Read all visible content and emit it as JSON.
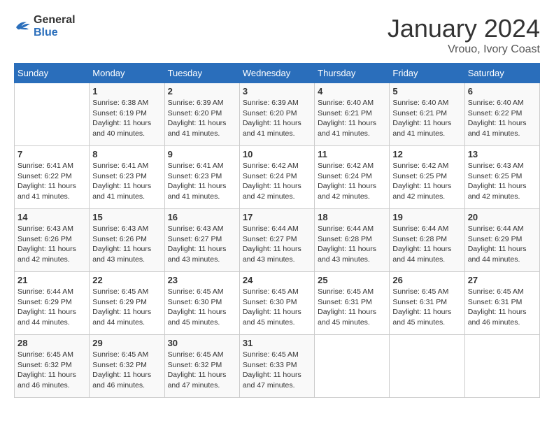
{
  "header": {
    "logo_general": "General",
    "logo_blue": "Blue",
    "month": "January 2024",
    "location": "Vrouo, Ivory Coast"
  },
  "weekdays": [
    "Sunday",
    "Monday",
    "Tuesday",
    "Wednesday",
    "Thursday",
    "Friday",
    "Saturday"
  ],
  "weeks": [
    [
      {
        "day": "",
        "sunrise": "",
        "sunset": "",
        "daylight": ""
      },
      {
        "day": "1",
        "sunrise": "Sunrise: 6:38 AM",
        "sunset": "Sunset: 6:19 PM",
        "daylight": "Daylight: 11 hours and 40 minutes."
      },
      {
        "day": "2",
        "sunrise": "Sunrise: 6:39 AM",
        "sunset": "Sunset: 6:20 PM",
        "daylight": "Daylight: 11 hours and 41 minutes."
      },
      {
        "day": "3",
        "sunrise": "Sunrise: 6:39 AM",
        "sunset": "Sunset: 6:20 PM",
        "daylight": "Daylight: 11 hours and 41 minutes."
      },
      {
        "day": "4",
        "sunrise": "Sunrise: 6:40 AM",
        "sunset": "Sunset: 6:21 PM",
        "daylight": "Daylight: 11 hours and 41 minutes."
      },
      {
        "day": "5",
        "sunrise": "Sunrise: 6:40 AM",
        "sunset": "Sunset: 6:21 PM",
        "daylight": "Daylight: 11 hours and 41 minutes."
      },
      {
        "day": "6",
        "sunrise": "Sunrise: 6:40 AM",
        "sunset": "Sunset: 6:22 PM",
        "daylight": "Daylight: 11 hours and 41 minutes."
      }
    ],
    [
      {
        "day": "7",
        "sunrise": "Sunrise: 6:41 AM",
        "sunset": "Sunset: 6:22 PM",
        "daylight": "Daylight: 11 hours and 41 minutes."
      },
      {
        "day": "8",
        "sunrise": "Sunrise: 6:41 AM",
        "sunset": "Sunset: 6:23 PM",
        "daylight": "Daylight: 11 hours and 41 minutes."
      },
      {
        "day": "9",
        "sunrise": "Sunrise: 6:41 AM",
        "sunset": "Sunset: 6:23 PM",
        "daylight": "Daylight: 11 hours and 41 minutes."
      },
      {
        "day": "10",
        "sunrise": "Sunrise: 6:42 AM",
        "sunset": "Sunset: 6:24 PM",
        "daylight": "Daylight: 11 hours and 42 minutes."
      },
      {
        "day": "11",
        "sunrise": "Sunrise: 6:42 AM",
        "sunset": "Sunset: 6:24 PM",
        "daylight": "Daylight: 11 hours and 42 minutes."
      },
      {
        "day": "12",
        "sunrise": "Sunrise: 6:42 AM",
        "sunset": "Sunset: 6:25 PM",
        "daylight": "Daylight: 11 hours and 42 minutes."
      },
      {
        "day": "13",
        "sunrise": "Sunrise: 6:43 AM",
        "sunset": "Sunset: 6:25 PM",
        "daylight": "Daylight: 11 hours and 42 minutes."
      }
    ],
    [
      {
        "day": "14",
        "sunrise": "Sunrise: 6:43 AM",
        "sunset": "Sunset: 6:26 PM",
        "daylight": "Daylight: 11 hours and 42 minutes."
      },
      {
        "day": "15",
        "sunrise": "Sunrise: 6:43 AM",
        "sunset": "Sunset: 6:26 PM",
        "daylight": "Daylight: 11 hours and 43 minutes."
      },
      {
        "day": "16",
        "sunrise": "Sunrise: 6:43 AM",
        "sunset": "Sunset: 6:27 PM",
        "daylight": "Daylight: 11 hours and 43 minutes."
      },
      {
        "day": "17",
        "sunrise": "Sunrise: 6:44 AM",
        "sunset": "Sunset: 6:27 PM",
        "daylight": "Daylight: 11 hours and 43 minutes."
      },
      {
        "day": "18",
        "sunrise": "Sunrise: 6:44 AM",
        "sunset": "Sunset: 6:28 PM",
        "daylight": "Daylight: 11 hours and 43 minutes."
      },
      {
        "day": "19",
        "sunrise": "Sunrise: 6:44 AM",
        "sunset": "Sunset: 6:28 PM",
        "daylight": "Daylight: 11 hours and 44 minutes."
      },
      {
        "day": "20",
        "sunrise": "Sunrise: 6:44 AM",
        "sunset": "Sunset: 6:29 PM",
        "daylight": "Daylight: 11 hours and 44 minutes."
      }
    ],
    [
      {
        "day": "21",
        "sunrise": "Sunrise: 6:44 AM",
        "sunset": "Sunset: 6:29 PM",
        "daylight": "Daylight: 11 hours and 44 minutes."
      },
      {
        "day": "22",
        "sunrise": "Sunrise: 6:45 AM",
        "sunset": "Sunset: 6:29 PM",
        "daylight": "Daylight: 11 hours and 44 minutes."
      },
      {
        "day": "23",
        "sunrise": "Sunrise: 6:45 AM",
        "sunset": "Sunset: 6:30 PM",
        "daylight": "Daylight: 11 hours and 45 minutes."
      },
      {
        "day": "24",
        "sunrise": "Sunrise: 6:45 AM",
        "sunset": "Sunset: 6:30 PM",
        "daylight": "Daylight: 11 hours and 45 minutes."
      },
      {
        "day": "25",
        "sunrise": "Sunrise: 6:45 AM",
        "sunset": "Sunset: 6:31 PM",
        "daylight": "Daylight: 11 hours and 45 minutes."
      },
      {
        "day": "26",
        "sunrise": "Sunrise: 6:45 AM",
        "sunset": "Sunset: 6:31 PM",
        "daylight": "Daylight: 11 hours and 45 minutes."
      },
      {
        "day": "27",
        "sunrise": "Sunrise: 6:45 AM",
        "sunset": "Sunset: 6:31 PM",
        "daylight": "Daylight: 11 hours and 46 minutes."
      }
    ],
    [
      {
        "day": "28",
        "sunrise": "Sunrise: 6:45 AM",
        "sunset": "Sunset: 6:32 PM",
        "daylight": "Daylight: 11 hours and 46 minutes."
      },
      {
        "day": "29",
        "sunrise": "Sunrise: 6:45 AM",
        "sunset": "Sunset: 6:32 PM",
        "daylight": "Daylight: 11 hours and 46 minutes."
      },
      {
        "day": "30",
        "sunrise": "Sunrise: 6:45 AM",
        "sunset": "Sunset: 6:32 PM",
        "daylight": "Daylight: 11 hours and 47 minutes."
      },
      {
        "day": "31",
        "sunrise": "Sunrise: 6:45 AM",
        "sunset": "Sunset: 6:33 PM",
        "daylight": "Daylight: 11 hours and 47 minutes."
      },
      {
        "day": "",
        "sunrise": "",
        "sunset": "",
        "daylight": ""
      },
      {
        "day": "",
        "sunrise": "",
        "sunset": "",
        "daylight": ""
      },
      {
        "day": "",
        "sunrise": "",
        "sunset": "",
        "daylight": ""
      }
    ]
  ]
}
